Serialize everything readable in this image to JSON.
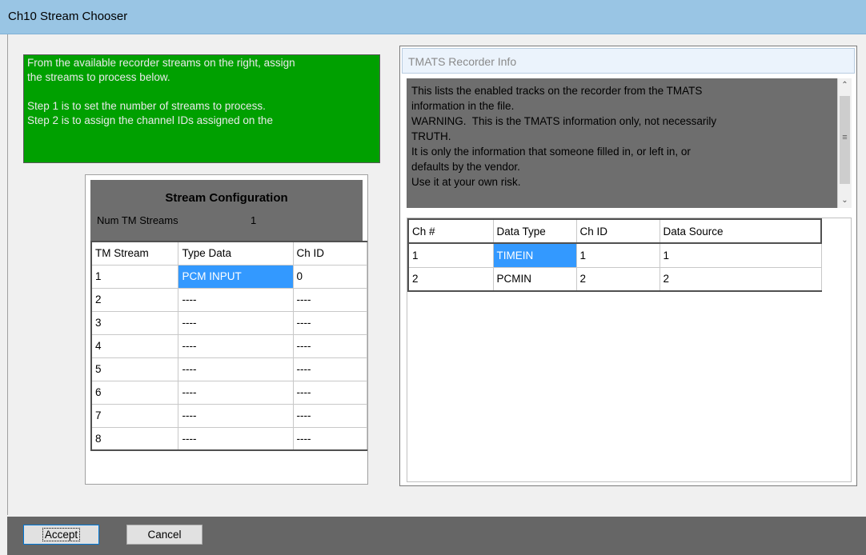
{
  "window": {
    "title": "Ch10 Stream Chooser"
  },
  "instructions": {
    "text": "From the available recorder streams on the right, assign\nthe streams to process below.\n\nStep 1 is to set the number of streams to process.\nStep 2 is to assign the channel IDs assigned on the"
  },
  "stream_config": {
    "heading": "Stream Configuration",
    "num_label": "Num TM Streams",
    "num_value": "1",
    "columns": [
      "TM Stream",
      "Type Data",
      "Ch ID"
    ],
    "rows": [
      [
        "1",
        "PCM INPUT",
        "0"
      ],
      [
        "2",
        "----",
        "----"
      ],
      [
        "3",
        "----",
        "----"
      ],
      [
        "4",
        "----",
        "----"
      ],
      [
        "5",
        "----",
        "----"
      ],
      [
        "6",
        "----",
        "----"
      ],
      [
        "7",
        "----",
        "----"
      ],
      [
        "8",
        "----",
        "----"
      ]
    ]
  },
  "tmats": {
    "title": "TMATS Recorder Info",
    "description": "This lists the enabled tracks on the recorder from the TMATS\ninformation in the file.\nWARNING.  This is the TMATS information only, not necessarily\nTRUTH.\nIt is only the information that someone filled in, or left in, or\ndefaults by the vendor.\nUse it at your own risk.",
    "columns": [
      "Ch #",
      "Data Type",
      "Ch ID",
      "Data Source"
    ],
    "rows": [
      [
        "1",
        "TIMEIN",
        "1",
        "1"
      ],
      [
        "2",
        "PCMIN",
        "2",
        "2"
      ]
    ]
  },
  "buttons": {
    "accept": "Accept",
    "cancel": "Cancel"
  },
  "colors": {
    "titlebar": "#99c5e4",
    "instructions_bg": "#00a000",
    "panel_gray": "#6e6e6e",
    "selection": "#3399ff",
    "footer": "#666666"
  }
}
